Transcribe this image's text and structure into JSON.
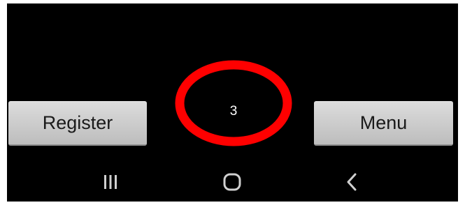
{
  "buttons": {
    "register_label": "Register",
    "menu_label": "Menu"
  },
  "counter": {
    "value": "3",
    "ring_color": "#ff0000"
  },
  "navbar": {
    "icons": [
      "recents-icon",
      "home-icon",
      "back-icon"
    ],
    "icon_color": "#d0d0d0"
  },
  "colors": {
    "background": "#000000",
    "button_face": "#cfcfcf",
    "button_text": "#1a1a1a"
  }
}
